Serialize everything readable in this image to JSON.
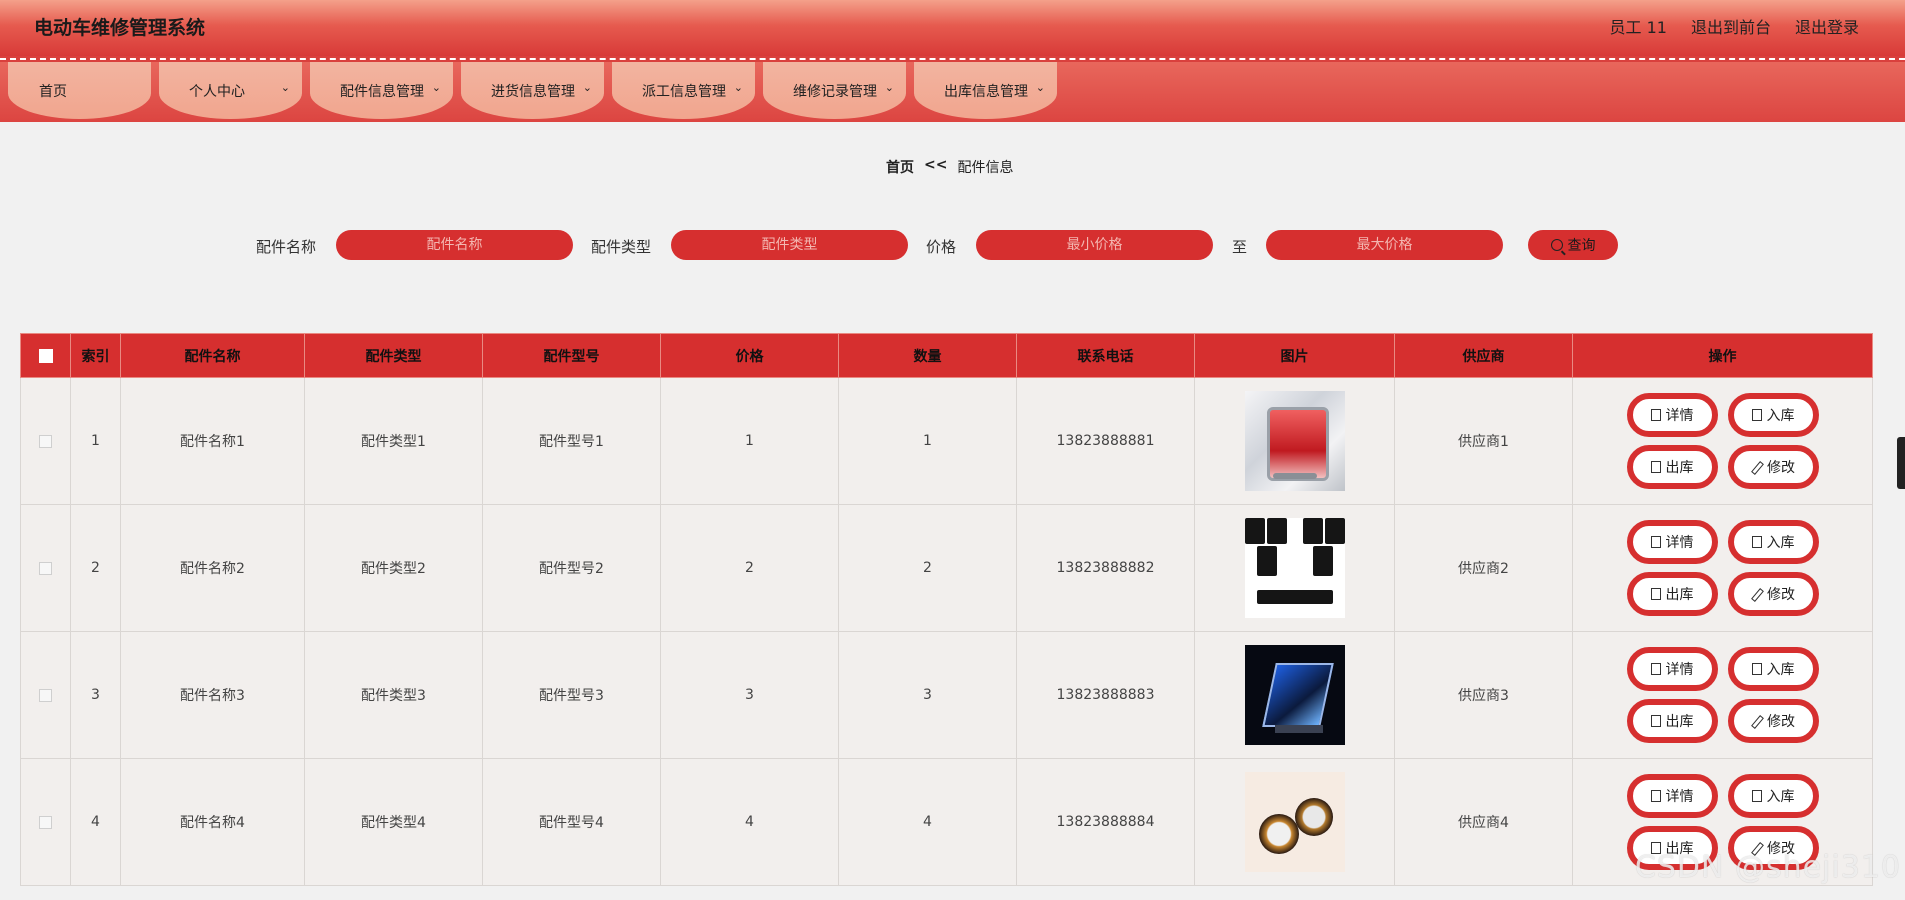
{
  "header": {
    "title": "电动车维修管理系统",
    "user": "员工 11",
    "to_front": "退出到前台",
    "logout": "退出登录"
  },
  "nav": {
    "items": [
      {
        "label": "首页",
        "dropdown": false
      },
      {
        "label": "个人中心",
        "dropdown": true
      },
      {
        "label": "配件信息管理",
        "dropdown": true
      },
      {
        "label": "进货信息管理",
        "dropdown": true
      },
      {
        "label": "派工信息管理",
        "dropdown": true
      },
      {
        "label": "维修记录管理",
        "dropdown": true
      },
      {
        "label": "出库信息管理",
        "dropdown": true
      }
    ]
  },
  "breadcrumb": {
    "home": "首页",
    "sep": "<<",
    "current": "配件信息"
  },
  "search": {
    "name_label": "配件名称",
    "name_placeholder": "配件名称",
    "type_label": "配件类型",
    "type_placeholder": "配件类型",
    "price_label": "价格",
    "min_placeholder": "最小价格",
    "to_label": "至",
    "max_placeholder": "最大价格",
    "query_label": "查询"
  },
  "table": {
    "columns": [
      "索引",
      "配件名称",
      "配件类型",
      "配件型号",
      "价格",
      "数量",
      "联系电话",
      "图片",
      "供应商",
      "操作"
    ],
    "rows": [
      {
        "index": "1",
        "name": "配件名称1",
        "type": "配件类型1",
        "model": "配件型号1",
        "price": "1",
        "qty": "1",
        "phone": "13823888881",
        "image": "pc-case-image",
        "supplier": "供应商1"
      },
      {
        "index": "2",
        "name": "配件名称2",
        "type": "配件类型2",
        "model": "配件型号2",
        "price": "2",
        "qty": "2",
        "phone": "13823888882",
        "image": "speakers-image",
        "supplier": "供应商2"
      },
      {
        "index": "3",
        "name": "配件名称3",
        "type": "配件类型3",
        "model": "配件型号3",
        "price": "3",
        "qty": "3",
        "phone": "13823888883",
        "image": "blue-pc-image",
        "supplier": "供应商3"
      },
      {
        "index": "4",
        "name": "配件名称4",
        "type": "配件类型4",
        "model": "配件型号4",
        "price": "4",
        "qty": "4",
        "phone": "13823888884",
        "image": "watches-image",
        "supplier": "供应商4"
      }
    ],
    "actions": {
      "detail": "详情",
      "stock_in": "入库",
      "stock_out": "出库",
      "edit": "修改"
    }
  },
  "watermark": "CSDN @sheji310",
  "colors": {
    "primary": "#d62f2f",
    "header_top": "#f4a08a",
    "background": "#f1f1f1"
  }
}
